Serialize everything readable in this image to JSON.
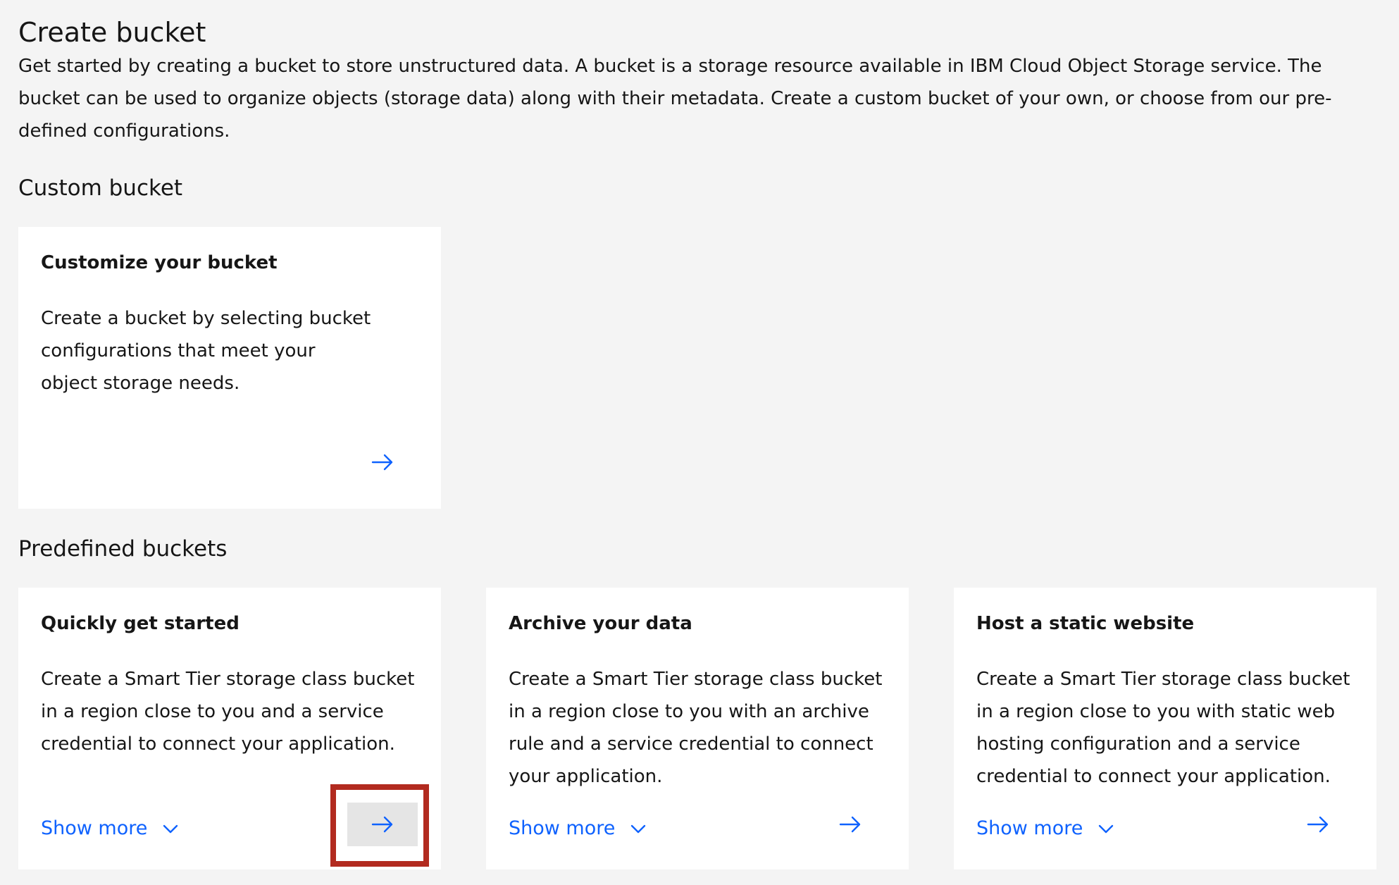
{
  "page": {
    "title": "Create bucket",
    "intro": "Get started by creating a bucket to store unstructured data. A bucket is a storage resource available in IBM Cloud Object Storage service. The bucket can be used to organize objects (storage data) along with their metadata. Create a custom bucket of your own, or choose from our pre-defined configurations."
  },
  "custom_section": {
    "title": "Custom bucket",
    "tile": {
      "title": "Customize your bucket",
      "description": "Create a bucket by selecting bucket configurations that meet your object storage needs.",
      "arrow_icon": "arrow-right-icon"
    }
  },
  "predefined_section": {
    "title": "Predefined buckets",
    "tiles": [
      {
        "title": "Quickly get started",
        "description": "Create a Smart Tier storage class bucket in a region close to you and a service credential to connect your application.",
        "show_more": "Show more",
        "arrow_icon": "arrow-right-icon"
      },
      {
        "title": "Archive your data",
        "description": "Create a Smart Tier storage class bucket in a region close to you with an archive rule and a service credential to connect your application.",
        "show_more": "Show more",
        "arrow_icon": "arrow-right-icon"
      },
      {
        "title": "Host a static website",
        "description": "Create a Smart Tier storage class bucket in a region close to you with static web hosting configuration and a service credential to connect your application.",
        "show_more": "Show more",
        "arrow_icon": "arrow-right-icon"
      }
    ]
  },
  "colors": {
    "background": "#f4f4f4",
    "tile": "#ffffff",
    "link": "#0f62fe",
    "highlight": "#b22a1f",
    "hover": "#e5e5e5"
  }
}
